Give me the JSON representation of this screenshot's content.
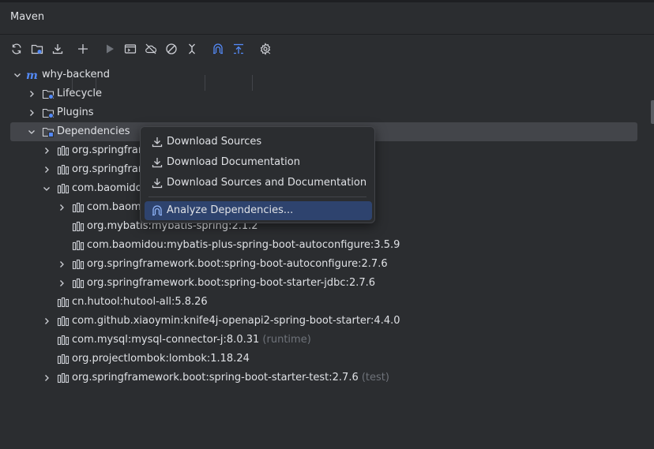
{
  "panel": {
    "title": "Maven"
  },
  "toolbar": {
    "buttons": [
      {
        "name": "reload-all-icon"
      },
      {
        "name": "add-maven-project-icon"
      },
      {
        "name": "download-icon"
      },
      {
        "name": "add-icon"
      },
      {
        "name": "run-icon"
      },
      {
        "name": "execute-goal-icon"
      },
      {
        "name": "offline-mode-icon"
      },
      {
        "name": "skip-tests-icon"
      },
      {
        "name": "collapse-all-icon"
      },
      {
        "name": "analyze-dependencies-icon"
      },
      {
        "name": "show-dependencies-icon"
      },
      {
        "name": "settings-icon"
      }
    ]
  },
  "tree": {
    "root": "why-backend",
    "lifecycle": "Lifecycle",
    "plugins": "Plugins",
    "dependencies": "Dependencies",
    "items": [
      {
        "label": "org.springframework.boot:spring-boot-starter-web:2.7.6",
        "suffix": ""
      },
      {
        "label": "org.springframework.boot:spring-boot-starter-aop:2.7.6",
        "suffix": ""
      },
      {
        "label": "com.baomidou:mybatis-plus-boot-starter:3.5.9",
        "suffix": ""
      },
      {
        "label": "com.baomidou:mybatis-plus:3.5.9",
        "suffix": ""
      },
      {
        "label": "org.mybatis:mybatis-spring:2.1.2",
        "suffix": ""
      },
      {
        "label": "com.baomidou:mybatis-plus-spring-boot-autoconfigure:3.5.9",
        "suffix": ""
      },
      {
        "label": "org.springframework.boot:spring-boot-autoconfigure:2.7.6",
        "suffix": ""
      },
      {
        "label": "org.springframework.boot:spring-boot-starter-jdbc:2.7.6",
        "suffix": ""
      },
      {
        "label": "cn.hutool:hutool-all:5.8.26",
        "suffix": ""
      },
      {
        "label": "com.github.xiaoymin:knife4j-openapi2-spring-boot-starter:4.4.0",
        "suffix": ""
      },
      {
        "label": "com.mysql:mysql-connector-j:8.0.31",
        "suffix": "(runtime)"
      },
      {
        "label": "org.projectlombok:lombok:1.18.24",
        "suffix": ""
      },
      {
        "label": "org.springframework.boot:spring-boot-starter-test:2.7.6",
        "suffix": "(test)"
      }
    ]
  },
  "context_menu": {
    "items": [
      {
        "label": "Download Sources",
        "icon": "download-icon"
      },
      {
        "label": "Download Documentation",
        "icon": "download-icon"
      },
      {
        "label": "Download Sources and Documentation",
        "icon": "download-icon"
      },
      {
        "label": "Analyze Dependencies...",
        "icon": "analyze-dependencies-icon",
        "active": true
      }
    ]
  },
  "colors": {
    "background": "#2b2d30",
    "selection": "#43454a",
    "menu_active": "#2e436e",
    "accent_blue": "#548af7",
    "muted": "#6f737a"
  }
}
